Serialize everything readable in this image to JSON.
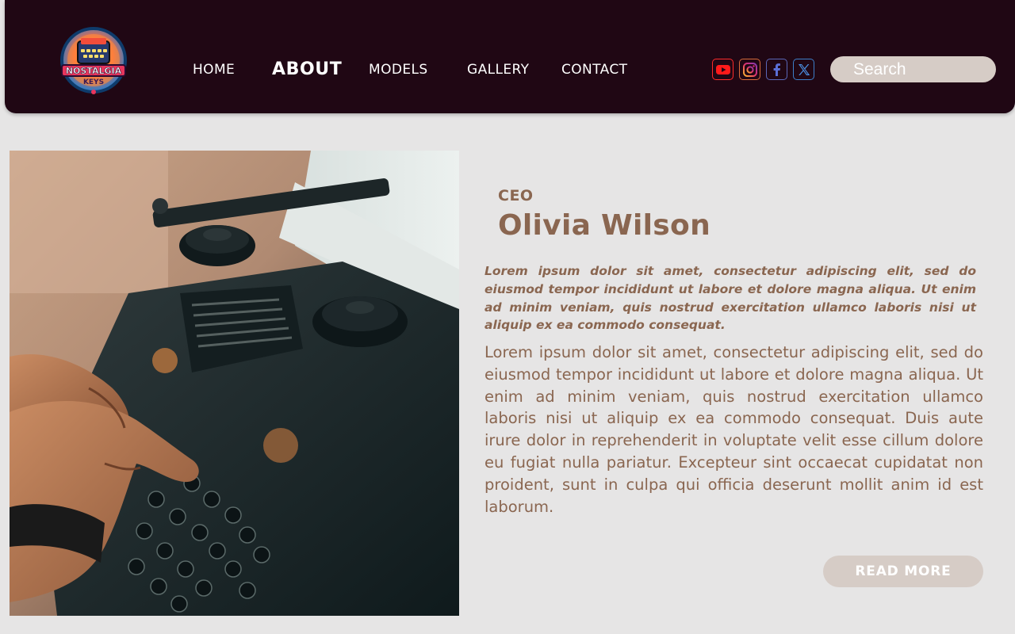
{
  "brand": {
    "logo_text_line1": "NOSTALGIA",
    "logo_text_line2": "KEYS"
  },
  "nav": {
    "items": [
      {
        "label": "HOME"
      },
      {
        "label": "ABOUT"
      },
      {
        "label": "MODELS"
      },
      {
        "label": "GALLERY"
      },
      {
        "label": "CONTACT"
      }
    ],
    "active": "ABOUT"
  },
  "social": [
    {
      "icon": "youtube-icon",
      "color": "#ff0000"
    },
    {
      "icon": "instagram-icon",
      "color": "#e1306c"
    },
    {
      "icon": "facebook-icon",
      "color": "#1877f2"
    },
    {
      "icon": "x-icon",
      "color": "#1da1f2"
    }
  ],
  "search": {
    "placeholder": "Search"
  },
  "profile": {
    "role": "CEO",
    "name": "Olivia Wilson",
    "lead": "Lorem ipsum dolor sit amet, consectetur adipiscing elit, sed do eiusmod tempor incididunt ut labore et dolore magna aliqua. Ut enim ad minim veniam, quis nostrud exercitation ullamco laboris nisi ut aliquip ex ea commodo consequat.",
    "body": "Lorem ipsum dolor sit amet, consectetur adipiscing elit, sed do eiusmod tempor incididunt ut labore et dolore magna aliqua. Ut enim ad minim veniam, quis nostrud exercitation ullamco laboris nisi ut aliquip ex ea commodo consequat. Duis aute irure dolor in reprehenderit in voluptate velit esse cillum dolore eu fugiat nulla pariatur. Excepteur sint occaecat cupidatat non proident, sunt in culpa qui officia deserunt mollit anim id est laborum.",
    "cta": "READ MORE"
  },
  "colors": {
    "header_bg": "#200714",
    "page_bg": "#e6e5e5",
    "accent_text": "#8a6650",
    "button_bg": "#d6ccc6"
  }
}
